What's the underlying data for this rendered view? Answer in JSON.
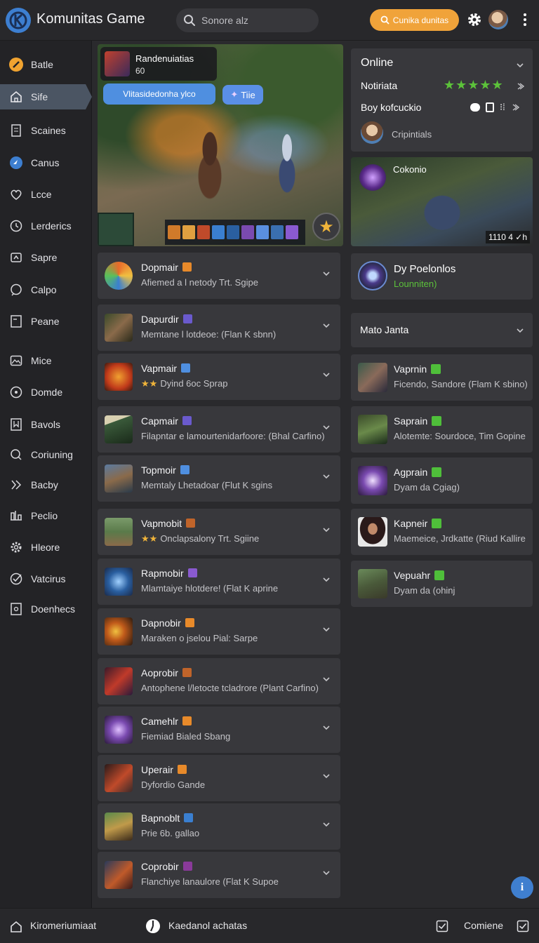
{
  "header": {
    "app_title": "Komunitas Game",
    "search_placeholder": "Sonore alz",
    "cta_label": "Cunika dunitas"
  },
  "sidebar": {
    "items": [
      {
        "label": "Batle",
        "icon": "battle-icon"
      },
      {
        "label": "Sife",
        "icon": "home-icon"
      },
      {
        "label": "Scaines",
        "icon": "document-icon"
      },
      {
        "label": "Canus",
        "icon": "compass-icon"
      },
      {
        "label": "Lcce",
        "icon": "heart-icon"
      },
      {
        "label": "Lerderics",
        "icon": "clock-icon"
      },
      {
        "label": "Sapre",
        "icon": "share-icon"
      },
      {
        "label": "Calpo",
        "icon": "chat-icon"
      },
      {
        "label": "Peane",
        "icon": "list-icon"
      },
      {
        "label": "Mice",
        "icon": "image-icon"
      },
      {
        "label": "Domde",
        "icon": "target-icon"
      },
      {
        "label": "Bavols",
        "icon": "bookmark-icon"
      },
      {
        "label": "Coriuning",
        "icon": "search-icon"
      },
      {
        "label": "Bacby",
        "icon": "arrow-icon"
      },
      {
        "label": "Peclio",
        "icon": "bars-icon"
      },
      {
        "label": "Hleore",
        "icon": "settings-icon"
      },
      {
        "label": "Vatcirus",
        "icon": "check-icon"
      },
      {
        "label": "Doenhecs",
        "icon": "box-icon"
      }
    ]
  },
  "hero": {
    "card_title": "Randenuiatias",
    "card_sub": "60",
    "pill_label": "Vlitasidedonha ylco",
    "tag_label": "Tiie"
  },
  "main_list": [
    {
      "title": "Dopmair",
      "sub": "Afiemed a l netody Trt. Sgipe",
      "stars": "",
      "badge": "#e88a2a"
    },
    {
      "title": "Dapurdir",
      "sub": "Memtane l lotdeoe: (Flan K sbnn)",
      "stars": "",
      "badge": "#6a5acd"
    },
    {
      "title": "Vapmair",
      "sub": "Dyind 6oc Sprap",
      "stars": "★★",
      "badge": "#4f8fe0"
    },
    {
      "title": "Capmair",
      "sub": "Filapntar e lamourtenidarfoore: (Bhal Carfino)",
      "stars": "",
      "badge": "#6a5acd"
    },
    {
      "title": "Topmoir",
      "sub": "Memtaly Lhetadoar  (Flut K sgins",
      "stars": "",
      "badge": "#4f8fe0"
    },
    {
      "title": "Vapmobit",
      "sub": "Onclapsalony Trt. Sgiine",
      "stars": "★★",
      "badge": "#c0642a"
    },
    {
      "title": "Rapmobir",
      "sub": "Mlamtaiye hlotdere! (Flat K aprine",
      "stars": "",
      "badge": "#8a5ad0"
    },
    {
      "title": "Dapnobir",
      "sub": "Maraken o jselou Pial: Sarpe",
      "stars": "",
      "badge": "#e88a2a"
    },
    {
      "title": "Aoprobir",
      "sub": "Antophene l/letocte tcladrore (Plant Carfino)",
      "stars": "",
      "badge": "#c0642a"
    },
    {
      "title": "Camehlr",
      "sub": "Fiemiad Bialed Sbang",
      "stars": "",
      "badge": "#e88a2a"
    },
    {
      "title": "Uperair",
      "sub": "Dyfordio Gande",
      "stars": "",
      "badge": "#e88a2a"
    },
    {
      "title": "Bapnoblt",
      "sub": "Prie 6b. gallao",
      "stars": "",
      "badge": "#3a7fd0"
    },
    {
      "title": "Coprobir",
      "sub": "Flanchiye lanaulore (Flat K Supoe",
      "stars": "",
      "badge": "#8a3a9a"
    }
  ],
  "online_panel": {
    "title": "Online",
    "row1_label": "Notiriata",
    "row1_stars": "★★★★★",
    "row2_label": "Boy kofcuckio",
    "user_label": "Cripintials"
  },
  "video_card": {
    "title": "Cokonio",
    "overlay_count": "1110 4 ✓h"
  },
  "featured": {
    "title": "Dy Poelonlos",
    "sub": "Lounniten)"
  },
  "match_dropdown": {
    "label": "Mato Janta"
  },
  "right_list": [
    {
      "title": "Vaprnin",
      "sub": "Ficendo, Sandore (Flam K sbino)"
    },
    {
      "title": "Saprain",
      "sub": "Alotemte: Sourdoce, Tim Gopine"
    },
    {
      "title": "Agprain",
      "sub": "Dyam da Cgiag)"
    },
    {
      "title": "Kapneir",
      "sub": "Maemeice, Jrdkatte (Riud Kallire"
    },
    {
      "title": "Vepuahr",
      "sub": "Dyam da (ohinj"
    }
  ],
  "bottom": {
    "left_label": "Kiromeriumiaat",
    "center_label": "Kaedanol achatas",
    "right_label": "Comiene"
  },
  "colors": {
    "accent_blue": "#3d7fd1",
    "accent_orange": "#f0a33a",
    "accent_green": "#5cc23a",
    "card_bg": "#38383c"
  }
}
